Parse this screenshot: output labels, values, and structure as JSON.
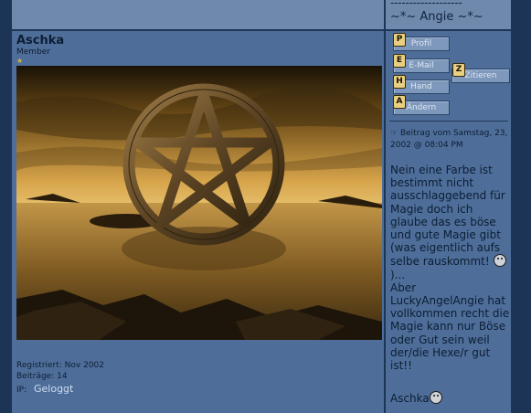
{
  "prev_post": {
    "dashes": "-------------------",
    "signature": "~*~ Angie ~*~"
  },
  "author": {
    "name": "Aschka",
    "rank": "Member",
    "stars": "★",
    "registered": "Registriert: Nov 2002",
    "posts": "Beiträge: 14",
    "ip_label": "IP:",
    "ip_value": "Geloggt"
  },
  "buttons": {
    "profile": {
      "key": "P",
      "label": "Profil"
    },
    "email": {
      "key": "E",
      "label": "E-Mail"
    },
    "quote": {
      "key": "Z",
      "label": "Zitieren"
    },
    "homepage": {
      "key": "H",
      "label": "Hand"
    },
    "edit": {
      "key": "A",
      "label": "Ändern"
    }
  },
  "post": {
    "icon": "pointing-hand-icon",
    "header": "Beitrag vom Samstag, 23, 2002 @ 08:04 PM",
    "body_p1": "Nein eine Farbe ist bestimmt nicht ausschlaggebend für Magie doch ich glaube das es böse und gute Magie gibt (was eigentlich aufs selbe rauskommt!",
    "body_p1_end": ")...",
    "body_p2": "Aber LuckyAngelAngie hat vollkommen recht die Magie kann nur Böse oder Gut sein weil der/die Hexe/r gut ist!!",
    "signature": "Aschka"
  },
  "colors": {
    "panel": "#4e6e99",
    "header_band": "#6f89ad",
    "border": "#1c3557",
    "text": "#0c1d33",
    "link": "#cfdcf0"
  }
}
